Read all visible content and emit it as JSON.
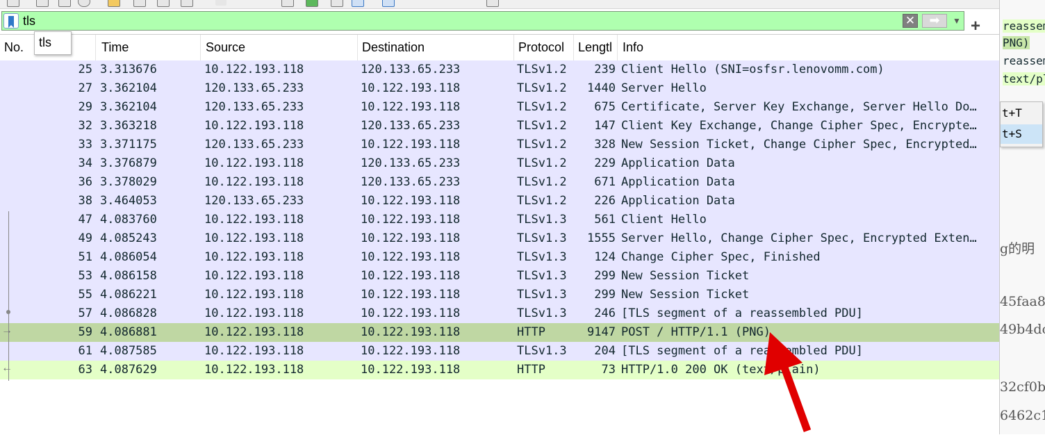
{
  "filter": {
    "value": "tls",
    "autocomplete_suggestion": "tls",
    "clear_icon": "clear-x-icon",
    "apply_icon": "apply-arrow-icon",
    "add_symbol": "+"
  },
  "columns": [
    "No.",
    "Time",
    "Source",
    "Destination",
    "Protocol",
    "Lengtl",
    "Info"
  ],
  "rows": [
    {
      "no": "25",
      "time": "3.313676",
      "src": "10.122.193.118",
      "dst": "120.133.65.233",
      "proto": "TLSv1.2",
      "len": "239",
      "info": "Client Hello (SNI=osfsr.lenovomm.com)"
    },
    {
      "no": "27",
      "time": "3.362104",
      "src": "120.133.65.233",
      "dst": "10.122.193.118",
      "proto": "TLSv1.2",
      "len": "1440",
      "info": "Server Hello"
    },
    {
      "no": "29",
      "time": "3.362104",
      "src": "120.133.65.233",
      "dst": "10.122.193.118",
      "proto": "TLSv1.2",
      "len": "675",
      "info": "Certificate, Server Key Exchange, Server Hello Do…"
    },
    {
      "no": "32",
      "time": "3.363218",
      "src": "10.122.193.118",
      "dst": "120.133.65.233",
      "proto": "TLSv1.2",
      "len": "147",
      "info": "Client Key Exchange, Change Cipher Spec, Encrypte…"
    },
    {
      "no": "33",
      "time": "3.371175",
      "src": "120.133.65.233",
      "dst": "10.122.193.118",
      "proto": "TLSv1.2",
      "len": "328",
      "info": "New Session Ticket, Change Cipher Spec, Encrypted…"
    },
    {
      "no": "34",
      "time": "3.376879",
      "src": "10.122.193.118",
      "dst": "120.133.65.233",
      "proto": "TLSv1.2",
      "len": "229",
      "info": "Application Data"
    },
    {
      "no": "36",
      "time": "3.378029",
      "src": "10.122.193.118",
      "dst": "120.133.65.233",
      "proto": "TLSv1.2",
      "len": "671",
      "info": "Application Data"
    },
    {
      "no": "38",
      "time": "3.464053",
      "src": "120.133.65.233",
      "dst": "10.122.193.118",
      "proto": "TLSv1.2",
      "len": "226",
      "info": "Application Data"
    },
    {
      "no": "47",
      "time": "4.083760",
      "src": "10.122.193.118",
      "dst": "10.122.193.118",
      "proto": "TLSv1.3",
      "len": "561",
      "info": "Client Hello"
    },
    {
      "no": "49",
      "time": "4.085243",
      "src": "10.122.193.118",
      "dst": "10.122.193.118",
      "proto": "TLSv1.3",
      "len": "1555",
      "info": "Server Hello, Change Cipher Spec, Encrypted Exten…"
    },
    {
      "no": "51",
      "time": "4.086054",
      "src": "10.122.193.118",
      "dst": "10.122.193.118",
      "proto": "TLSv1.3",
      "len": "124",
      "info": "Change Cipher Spec, Finished"
    },
    {
      "no": "53",
      "time": "4.086158",
      "src": "10.122.193.118",
      "dst": "10.122.193.118",
      "proto": "TLSv1.3",
      "len": "299",
      "info": "New Session Ticket"
    },
    {
      "no": "55",
      "time": "4.086221",
      "src": "10.122.193.118",
      "dst": "10.122.193.118",
      "proto": "TLSv1.3",
      "len": "299",
      "info": "New Session Ticket"
    },
    {
      "no": "57",
      "time": "4.086828",
      "src": "10.122.193.118",
      "dst": "10.122.193.118",
      "proto": "TLSv1.3",
      "len": "246",
      "info": "[TLS segment of a reassembled PDU]"
    },
    {
      "no": "59",
      "time": "4.086881",
      "src": "10.122.193.118",
      "dst": "10.122.193.118",
      "proto": "HTTP",
      "len": "9147",
      "info": "POST / HTTP/1.1  (PNG)"
    },
    {
      "no": "61",
      "time": "4.087585",
      "src": "10.122.193.118",
      "dst": "10.122.193.118",
      "proto": "TLSv1.3",
      "len": "204",
      "info": "[TLS segment of a reassembled PDU]"
    },
    {
      "no": "63",
      "time": "4.087629",
      "src": "10.122.193.118",
      "dst": "10.122.193.118",
      "proto": "HTTP",
      "len": "73",
      "info": "HTTP/1.0 200 OK  (text/plain)"
    }
  ],
  "colors": {
    "filter_valid": "#afffaf",
    "row_tls": "#e7e6ff",
    "row_http_selected": "#bfd7a3",
    "row_http": "#e4ffc7",
    "annotation_arrow": "#e00000"
  },
  "right_panel": {
    "lines": [
      "reassem",
      "PNG)",
      "reassem",
      "text/pl"
    ],
    "menu_items": [
      "t+T",
      "t+S"
    ],
    "text_lines": [
      "g的明",
      "45faa8",
      "49b4dc",
      "32cf0b",
      "6462c1"
    ]
  }
}
